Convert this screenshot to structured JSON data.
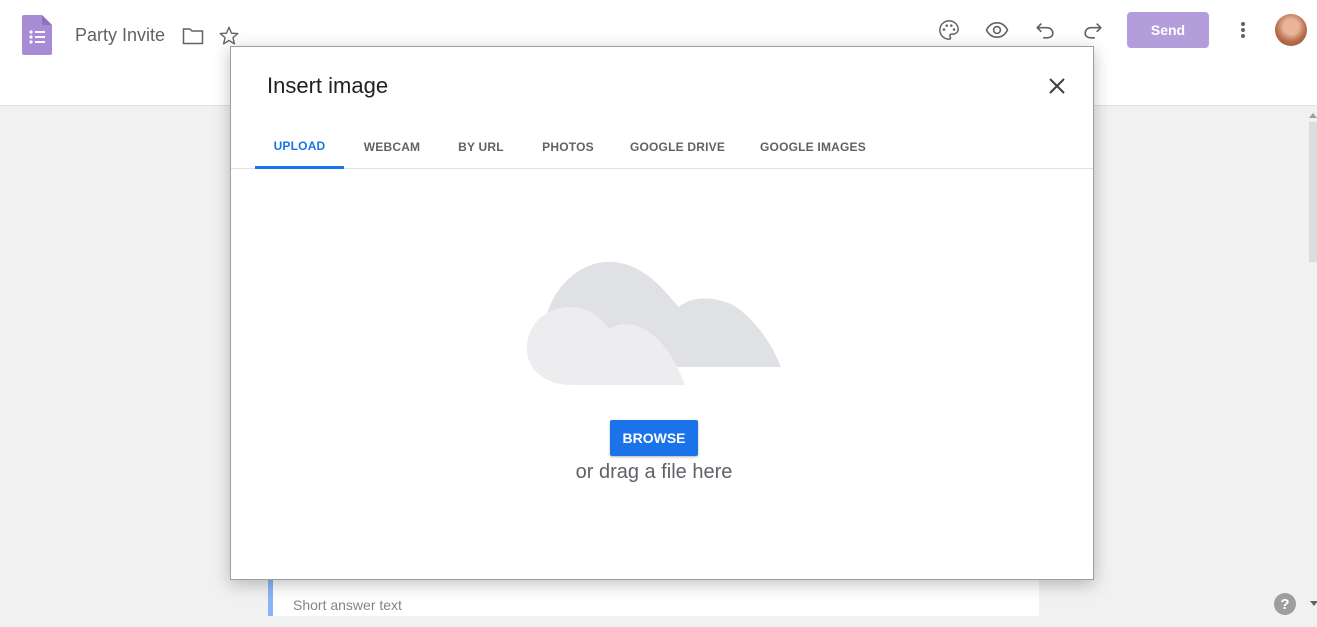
{
  "header": {
    "title": "Party Invite",
    "send_label": "Send",
    "icons": [
      "forms-logo",
      "folder-icon",
      "star-icon",
      "palette-icon",
      "eye-icon",
      "undo-icon",
      "redo-icon",
      "more-vert-icon",
      "avatar"
    ]
  },
  "form": {
    "short_answer_placeholder": "Short answer text"
  },
  "dialog": {
    "title": "Insert image",
    "tabs": [
      {
        "label": "UPLOAD",
        "active": true
      },
      {
        "label": "WEBCAM",
        "active": false
      },
      {
        "label": "BY URL",
        "active": false
      },
      {
        "label": "PHOTOS",
        "active": false
      },
      {
        "label": "GOOGLE DRIVE",
        "active": false
      },
      {
        "label": "GOOGLE IMAGES",
        "active": false
      }
    ],
    "browse_label": "BROWSE",
    "drag_text": "or drag a file here"
  },
  "help": {
    "label": "?"
  },
  "colors": {
    "accent": "#1a73e8",
    "send_bg": "#b39ddb",
    "forms_purple": "#a88bd5",
    "tab_underline": "#1a73e8"
  }
}
